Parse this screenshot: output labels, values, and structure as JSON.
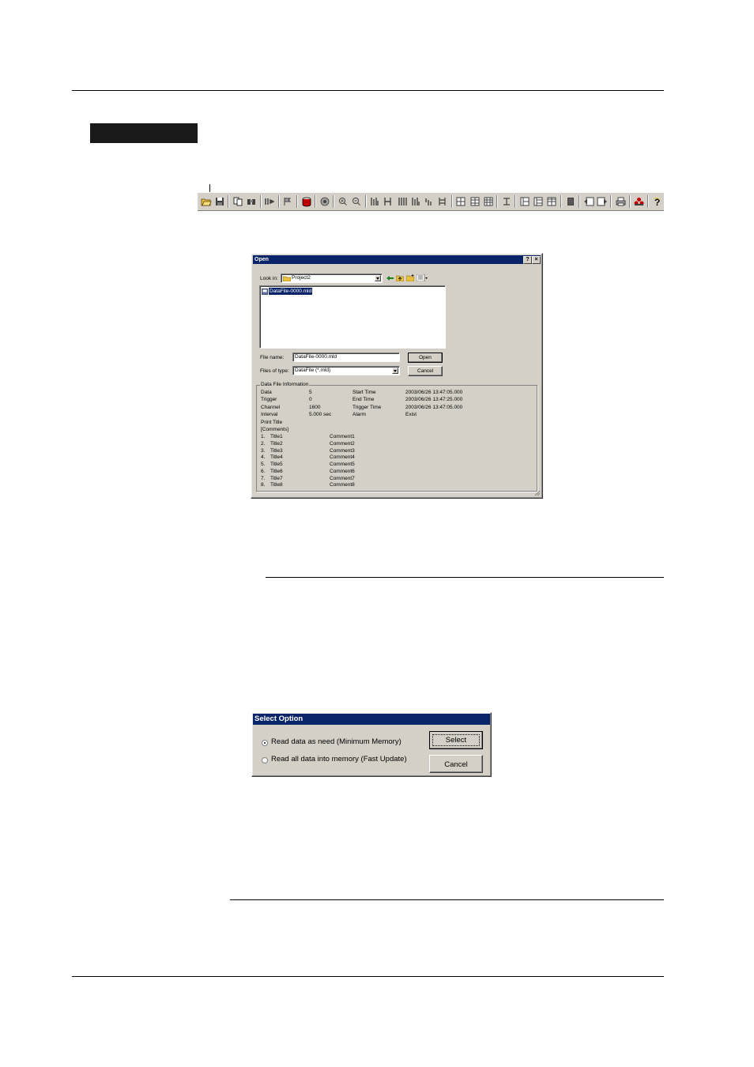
{
  "toolbar": {
    "icons": [
      "open-file-icon",
      "save-icon",
      "copy-icon",
      "find-icon",
      "jump-icon",
      "marker-icon",
      "database-icon",
      "record-icon",
      "zoom-in-icon",
      "zoom-out-icon",
      "cursor-a-icon",
      "cursor-b-icon",
      "bars-icon",
      "bars2-icon",
      "step-icon",
      "trigger-icon",
      "grid1-icon",
      "grid2-icon",
      "grid3-icon",
      "align-icon",
      "split1-icon",
      "split2-icon",
      "split3-icon",
      "sheet-icon",
      "back-icon",
      "forward-icon",
      "print-icon",
      "group-icon",
      "help-icon"
    ]
  },
  "open_dialog": {
    "title": "Open",
    "help_btn": "?",
    "close_btn": "×",
    "look_in_label": "Look in:",
    "look_in_value": "Project2",
    "file_item": "DataFile-0000.mld",
    "file_name_label": "File name:",
    "file_name_value": "DataFile-0000.mld",
    "files_of_type_label": "Files of type:",
    "files_of_type_value": "DataFile (*.mld)",
    "open_btn": "Open",
    "cancel_btn": "Cancel",
    "info_group_label": "Data File Information",
    "info": {
      "data_label": "Data",
      "data_value": "5",
      "trigger_label": "Trigger",
      "trigger_value": "0",
      "channel_label": "Channel",
      "channel_value": "1600",
      "interval_label": "Interval",
      "interval_value": "5.000 sec",
      "start_time_label": "Start Time",
      "start_time_value": "2003/06/26 13:47:05.000",
      "end_time_label": "End Time",
      "end_time_value": "2003/06/26 13:47:25.000",
      "trigger_time_label": "Trigger Time",
      "trigger_time_value": "2003/06/26 13:47:05.000",
      "alarm_label": "Alarm",
      "alarm_value": "Exist",
      "print_title": "Print Title",
      "comments": "[Comments]"
    },
    "rows": [
      {
        "num": "1.",
        "title": "Title1",
        "comment": "Comment1"
      },
      {
        "num": "2.",
        "title": "Title2",
        "comment": "Comment2"
      },
      {
        "num": "3.",
        "title": "Title3",
        "comment": "Comment3"
      },
      {
        "num": "4.",
        "title": "Title4",
        "comment": "Comment4"
      },
      {
        "num": "5.",
        "title": "Title5",
        "comment": "Comment5"
      },
      {
        "num": "6.",
        "title": "Title6",
        "comment": "Comment6"
      },
      {
        "num": "7.",
        "title": "Title7",
        "comment": "Comment7"
      },
      {
        "num": "8.",
        "title": "Title8",
        "comment": "Comment8"
      }
    ]
  },
  "select_dialog": {
    "title": "Select Option",
    "option1": "Read data as need (Minimum Memory)",
    "option2": "Read all data into memory (Fast Update)",
    "select_btn": "Select",
    "cancel_btn": "Cancel"
  }
}
